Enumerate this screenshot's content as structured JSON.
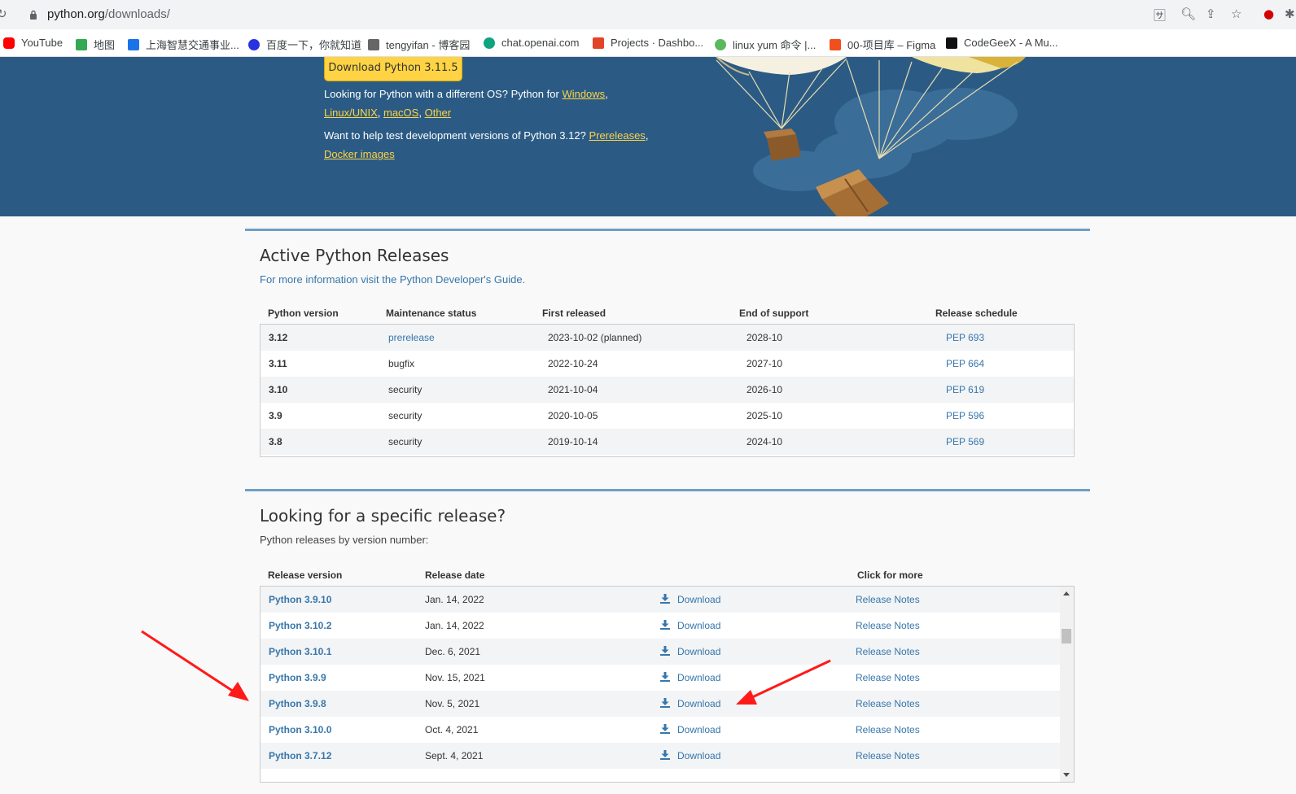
{
  "browser": {
    "url_host": "python.org",
    "url_path": "/downloads/",
    "bookmarks": [
      {
        "label": "YouTube",
        "color": "#ff0000"
      },
      {
        "label": "地图",
        "color": "#34a853"
      },
      {
        "label": "上海智慧交通事业...",
        "color": "#1a73e8"
      },
      {
        "label": "百度一下，你就知道",
        "color": "#2932e1"
      },
      {
        "label": "tengyifan - 博客园",
        "color": "#333333"
      },
      {
        "label": "chat.openai.com",
        "color": "#10a37f"
      },
      {
        "label": "Projects · Dashbo...",
        "color": "#e24329"
      },
      {
        "label": "linux yum 命令 |...",
        "color": "#5cb85c"
      },
      {
        "label": "00-项目库 – Figma",
        "color": "#f24e1e"
      },
      {
        "label": "CodeGeeX - A Mu...",
        "color": "#111111"
      }
    ]
  },
  "hero": {
    "download_button": "Download Python 3.11.5",
    "line1_prefix": "Looking for Python with a different OS? Python for ",
    "windows": "Windows",
    "comma": ",",
    "linux": "Linux/UNIX",
    "macos": "macOS",
    "other": "Other",
    "line3_prefix": "Want to help test development versions of Python 3.12? ",
    "prereleases": "Prereleases",
    "docker": "Docker images"
  },
  "active": {
    "title": "Active Python Releases",
    "subtitle": "For more information visit the Python Developer's Guide.",
    "headers": [
      "Python version",
      "Maintenance status",
      "First released",
      "End of support",
      "Release schedule"
    ],
    "rows": [
      {
        "version": "3.12",
        "status": "prerelease",
        "first": "2023-10-02 (planned)",
        "end": "2028-10",
        "pep": "PEP 693"
      },
      {
        "version": "3.11",
        "status": "bugfix",
        "first": "2022-10-24",
        "end": "2027-10",
        "pep": "PEP 664"
      },
      {
        "version": "3.10",
        "status": "security",
        "first": "2021-10-04",
        "end": "2026-10",
        "pep": "PEP 619"
      },
      {
        "version": "3.9",
        "status": "security",
        "first": "2020-10-05",
        "end": "2025-10",
        "pep": "PEP 596"
      },
      {
        "version": "3.8",
        "status": "security",
        "first": "2019-10-14",
        "end": "2024-10",
        "pep": "PEP 569"
      }
    ]
  },
  "specific": {
    "title": "Looking for a specific release?",
    "subtitle": "Python releases by version number:",
    "headers": [
      "Release version",
      "Release date",
      "Click for more"
    ],
    "rows": [
      {
        "version": "Python 3.9.10",
        "date": "Jan. 14, 2022",
        "download": "Download",
        "notes": "Release Notes"
      },
      {
        "version": "Python 3.10.2",
        "date": "Jan. 14, 2022",
        "download": "Download",
        "notes": "Release Notes"
      },
      {
        "version": "Python 3.10.1",
        "date": "Dec. 6, 2021",
        "download": "Download",
        "notes": "Release Notes"
      },
      {
        "version": "Python 3.9.9",
        "date": "Nov. 15, 2021",
        "download": "Download",
        "notes": "Release Notes"
      },
      {
        "version": "Python 3.9.8",
        "date": "Nov. 5, 2021",
        "download": "Download",
        "notes": "Release Notes"
      },
      {
        "version": "Python 3.10.0",
        "date": "Oct. 4, 2021",
        "download": "Download",
        "notes": "Release Notes"
      },
      {
        "version": "Python 3.7.12",
        "date": "Sept. 4, 2021",
        "download": "Download",
        "notes": "Release Notes"
      }
    ]
  },
  "colors": {
    "hero": "#2b5b84",
    "accent": "#ffd343",
    "link": "#3776ab",
    "arrow": "#ff1a1a"
  }
}
